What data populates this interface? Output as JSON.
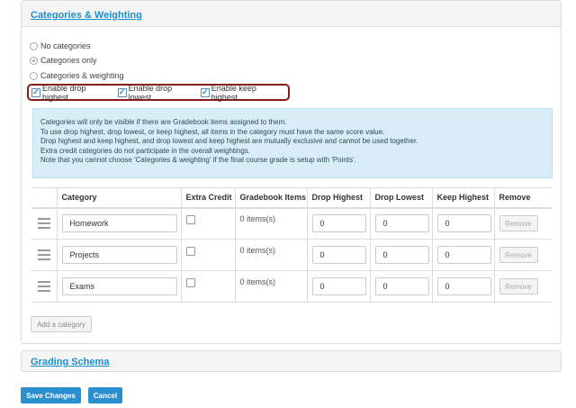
{
  "sections": {
    "categories_title": "Categories & Weighting",
    "grading_title": "Grading Schema"
  },
  "radios": [
    {
      "label": "No categories",
      "checked": false
    },
    {
      "label": "Categories only",
      "checked": true
    },
    {
      "label": "Categories & weighting",
      "checked": false
    }
  ],
  "enable_options": [
    {
      "label": "Enable drop highest",
      "checked": true
    },
    {
      "label": "Enable drop lowest",
      "checked": true
    },
    {
      "label": "Enable keep highest",
      "checked": true
    }
  ],
  "info_lines": [
    "Categories will only be visible if there are Gradebook items assigned to them.",
    "To use drop highest, drop lowest, or keep highest, all items in the category must have the same score value.",
    "Drop highest and keep highest, and drop lowest and keep highest are mutually exclusive and cannot be used together.",
    "Extra credit categories do not participate in the overall weightings.",
    "Note that you cannot choose 'Categories & weighting' if the final course grade is setup with 'Points'."
  ],
  "table": {
    "headers": [
      "Category",
      "Extra Credit",
      "Gradebook Items",
      "Drop Highest",
      "Drop Lowest",
      "Keep Highest",
      "Remove"
    ],
    "rows": [
      {
        "category": "Homework",
        "extra_credit": false,
        "items": "0 items(s)",
        "drop_highest": "0",
        "drop_lowest": "0",
        "keep_highest": "0",
        "remove_label": "Remove"
      },
      {
        "category": "Projects",
        "extra_credit": false,
        "items": "0 items(s)",
        "drop_highest": "0",
        "drop_lowest": "0",
        "keep_highest": "0",
        "remove_label": "Remove"
      },
      {
        "category": "Exams",
        "extra_credit": false,
        "items": "0 items(s)",
        "drop_highest": "0",
        "drop_lowest": "0",
        "keep_highest": "0",
        "remove_label": "Remove"
      }
    ]
  },
  "buttons": {
    "add_category": "Add a category",
    "save": "Save Changes",
    "cancel": "Cancel"
  },
  "colors": {
    "accent": "#2a8fcf",
    "highlight_border": "#8b1a1a",
    "info_bg": "#d9edf7"
  }
}
